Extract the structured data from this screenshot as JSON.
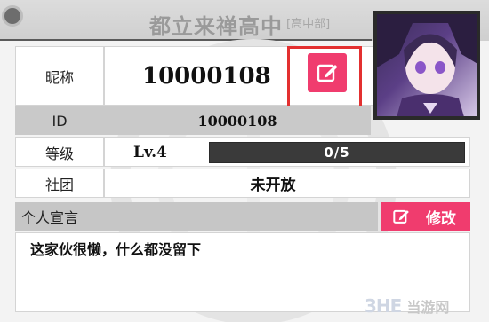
{
  "header": {
    "title": "都立来禅高中",
    "subtitle": "[高中部]"
  },
  "profile": {
    "nickname_label": "昵称",
    "nickname": "10000108",
    "id_label": "ID",
    "id_value": "10000108",
    "level_label": "等级",
    "level_value": "Lv.4",
    "exp_text": "0/5",
    "exp_progress": 0,
    "club_label": "社团",
    "club_value": "未开放",
    "declaration_label": "个人宣言",
    "modify_label": "修改",
    "declaration_text": "这家伙很懒，什么都没留下"
  },
  "watermark": {
    "logo": "3HE",
    "text": "当游网"
  },
  "colors": {
    "accent": "#f03c6e",
    "highlight": "#e33030",
    "header": "#cfcfcf"
  },
  "icons": {
    "edit": "pencil-edit-icon"
  }
}
